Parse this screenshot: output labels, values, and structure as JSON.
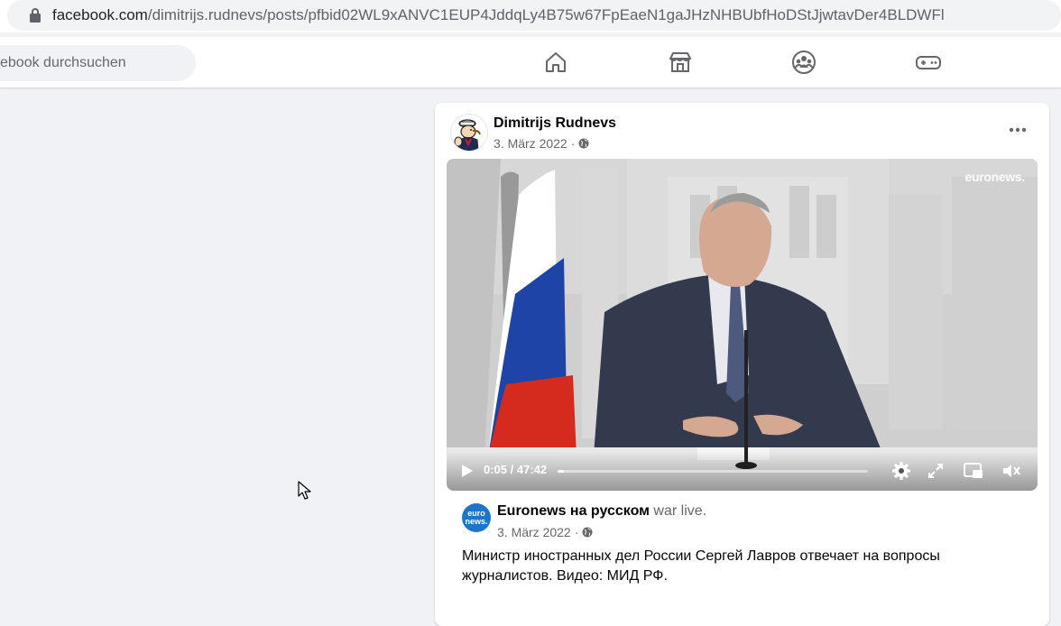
{
  "browser": {
    "url_host": "facebook.com",
    "url_path": "/dimitrijs.rudnevs/posts/pfbid02WL9xANVC1EUP4JddqLy4B75w67FpEaeN1gaJHzNHBUbfHoDStJjwtavDer4BLDWFl",
    "lock_icon": "lock-icon"
  },
  "topnav": {
    "search_placeholder": "ebook durchsuchen",
    "icons": [
      "home-icon",
      "marketplace-icon",
      "groups-icon",
      "gaming-icon"
    ]
  },
  "post": {
    "author": "Dimitrijs Rudnevs",
    "date": "3. März 2022",
    "separator": "·",
    "privacy_icon": "globe-icon",
    "more_icon": "more-icon",
    "video": {
      "watermark": "euronews.",
      "current_time": "0:05",
      "duration": "47:42",
      "time_display": "0:05 / 47:42",
      "progress_fraction": 0.002,
      "control_icons": [
        "play-icon",
        "settings-icon",
        "fullscreen-icon",
        "miniplayer-icon",
        "mute-icon"
      ]
    },
    "shared": {
      "avatar_line1": "euro",
      "avatar_line2": "news.",
      "page_name": "Euronews на русском",
      "action": "war live.",
      "date": "3. März 2022",
      "separator": "·",
      "text": "Министр иностранных дел России Сергей Лавров отвечает на вопросы журналистов. Видео: МИД РФ."
    }
  },
  "colors": {
    "background": "#f0f2f5",
    "card": "#ffffff",
    "primary_text": "#050505",
    "secondary_text": "#65676b",
    "euronews_blue": "#1e74c8"
  }
}
